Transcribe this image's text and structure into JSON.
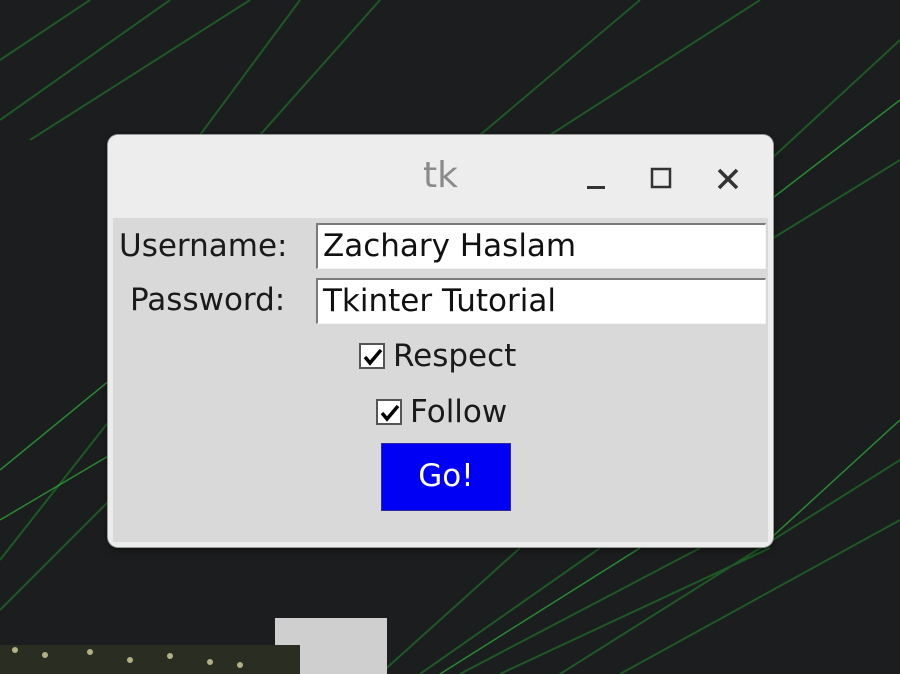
{
  "window": {
    "title": "tk",
    "controls": {
      "minimize_icon": "minimize-icon",
      "maximize_icon": "maximize-icon",
      "close_icon": "close-icon"
    }
  },
  "form": {
    "username_label": "Username:",
    "username_value": "Zachary Haslam",
    "password_label": "Password:",
    "password_value": "Tkinter Tutorial",
    "checkboxes": [
      {
        "label": "Respect",
        "checked": true
      },
      {
        "label": "Follow",
        "checked": true
      }
    ],
    "submit_label": "Go!"
  },
  "colors": {
    "button_bg": "#0000f5",
    "button_text": "#ffffff",
    "content_bg": "#d9d9d9",
    "titlebar_bg": "#ededed"
  }
}
